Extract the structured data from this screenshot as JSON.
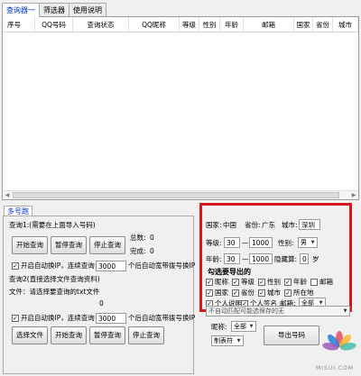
{
  "tabs": [
    "查询器一",
    "筛选器",
    "使用说明"
  ],
  "grid": {
    "columns": [
      "序号",
      "QQ号码",
      "查询状态",
      "QQ昵称",
      "等级",
      "性别",
      "年龄",
      "邮箱",
      "国家",
      "省份",
      "城市"
    ]
  },
  "multi_tab": "多号跑",
  "query1": {
    "title": "查询1:(需要在上面导入号码)",
    "buttons": [
      "开始查询",
      "暂停查询",
      "停止查询"
    ],
    "total_label": "总数:",
    "total_value": "0",
    "done_label": "完成:",
    "done_value": "0",
    "auto_ip_label": "开启自动换IP，连续查询",
    "auto_ip_checked": "✓",
    "auto_ip_value": "3000",
    "auto_ip_suffix": "个后自动宽带拨号换IP"
  },
  "query2": {
    "title": "查询2(直接选择文件查询资料)",
    "file_label": "文件：请选择要查询的txt文件",
    "count": "0",
    "auto_ip_label": "开启自动换IP，连续查询",
    "auto_ip_checked": "✓",
    "auto_ip_value": "3000",
    "auto_ip_suffix": "个后自动宽带拨号换IP",
    "buttons": [
      "选择文件",
      "开始查询",
      "暂停查询",
      "停止查询"
    ]
  },
  "filter": {
    "country_label": "国家:",
    "country_value": "中国",
    "province_label": "省份:",
    "province_value": "广东",
    "city_label": "城市:",
    "city_value": "深圳",
    "level_label": "等级:",
    "level_min": "30",
    "level_sep": "—",
    "level_max": "1000",
    "gender_label": "性别:",
    "gender_value": "男",
    "age_label": "年龄:",
    "age_min": "30",
    "age_sep": "—",
    "age_max": "1000",
    "hide_label": "隐藏算:",
    "hide_value": "0",
    "hide_suffix": "岁",
    "export_title": "勾选要导出的",
    "export_options_row1": [
      "昵称",
      "等级",
      "性别",
      "年龄",
      "邮箱"
    ],
    "export_checked_row1": [
      "✓",
      "✓",
      "✓",
      "✓",
      ""
    ],
    "export_options_row2": [
      "国家",
      "省份",
      "城市",
      "所在地"
    ],
    "export_checked_row2": [
      "✓",
      "✓",
      "✓",
      "✓"
    ],
    "export_options_row3": [
      "个人说明",
      "个人签名"
    ],
    "export_checked_row3": [
      "✓",
      "✓"
    ],
    "mailbox_label": "邮箱:",
    "mailbox_value": "全部"
  },
  "bottom_right": {
    "hint": "不自动匹配可能选保存的无",
    "nickname_label": "昵称:",
    "nickname_value": "全部",
    "sep_value": "制表符",
    "export_button": "导出号码"
  },
  "watermark": "MISUI.COM",
  "colors": {
    "highlight": "#d9161c",
    "tab_active": "#0033cc"
  }
}
